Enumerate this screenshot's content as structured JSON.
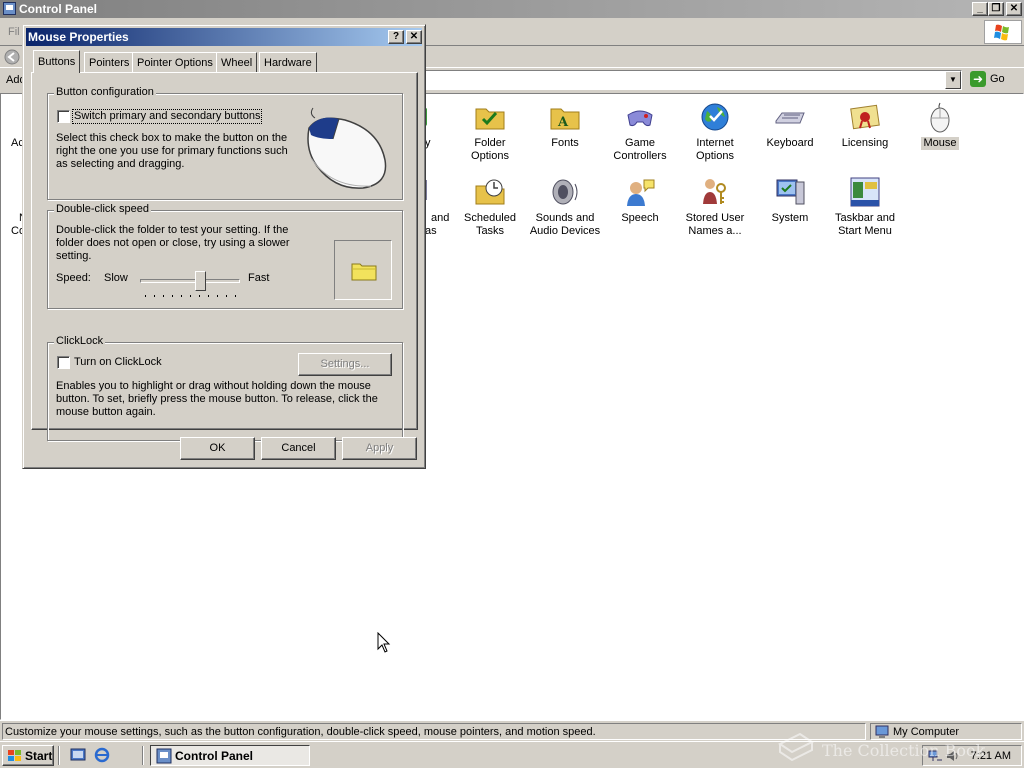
{
  "control_panel": {
    "title": "Control Panel",
    "menu_partial": "File",
    "address_label": "Address",
    "address_label_visible": "Add",
    "go_label": "Go",
    "items_row1": [
      {
        "label": "Folder Options",
        "icon": "folder-options-icon"
      },
      {
        "label": "Fonts",
        "icon": "fonts-icon"
      },
      {
        "label": "Game\nControllers",
        "icon": "game-controllers-icon"
      },
      {
        "label": "Internet\nOptions",
        "icon": "internet-options-icon"
      },
      {
        "label": "Keyboard",
        "icon": "keyboard-icon"
      },
      {
        "label": "Licensing",
        "icon": "licensing-icon"
      },
      {
        "label": "Mouse",
        "icon": "mouse-icon",
        "selected": true
      }
    ],
    "items_row2": [
      {
        "label": "Scheduled\nTasks",
        "icon": "scheduled-tasks-icon"
      },
      {
        "label": "Sounds and\nAudio Devices",
        "icon": "sounds-icon"
      },
      {
        "label": "Speech",
        "icon": "speech-icon"
      },
      {
        "label": "Stored User\nNames a...",
        "icon": "stored-user-names-icon"
      },
      {
        "label": "System",
        "icon": "system-icon"
      },
      {
        "label": "Taskbar and\nStart Menu",
        "icon": "taskbar-start-menu-icon"
      }
    ],
    "partial_labels": {
      "row1_left": "Ac",
      "row1_right": "y",
      "row2_left_a": "N",
      "row2_left_b": "Co",
      "row2_right_a": "and",
      "row2_right_b": "as"
    }
  },
  "status_bar": {
    "text": "Customize your mouse settings, such as the button configuration, double-click speed, mouse pointers, and motion speed.",
    "zone": "My Computer"
  },
  "taskbar": {
    "start_label": "Start",
    "task_label": "Control Panel",
    "clock": "7:21 AM"
  },
  "watermark": "The Collection Book",
  "dialog": {
    "title": "Mouse Properties",
    "help_glyph": "?",
    "close_glyph": "✕",
    "tabs": [
      "Buttons",
      "Pointers",
      "Pointer Options",
      "Wheel",
      "Hardware"
    ],
    "active_tab": "Buttons",
    "button_config": {
      "legend": "Button configuration",
      "checkbox_label": "Switch primary and secondary buttons",
      "checked": false,
      "description": "Select this check box to make the button on the right the one you use for primary functions such as selecting and dragging."
    },
    "double_click": {
      "legend": "Double-click speed",
      "description": "Double-click the folder to test your setting. If the folder does not open or close, try using a slower setting.",
      "speed_label": "Speed:",
      "slow_label": "Slow",
      "fast_label": "Fast",
      "slider_position": 0.6,
      "tick_count": 11
    },
    "clicklock": {
      "legend": "ClickLock",
      "checkbox_label": "Turn on ClickLock",
      "checked": false,
      "settings_label": "Settings...",
      "description": "Enables you to highlight or drag without holding down the mouse button. To set, briefly press the mouse button. To release, click the mouse button again."
    },
    "buttons": {
      "ok": "OK",
      "cancel": "Cancel",
      "apply": "Apply"
    }
  },
  "colors": {
    "dialog_title_start": "#0a246a",
    "dialog_title_end": "#a6caf0",
    "face": "#d4d0c8",
    "selection": "#d4d0c8"
  }
}
